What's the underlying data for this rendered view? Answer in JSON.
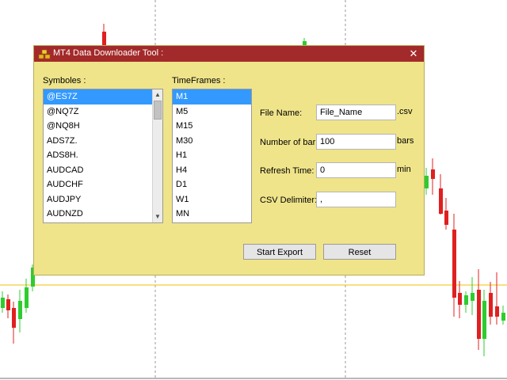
{
  "colors": {
    "title_bar": "#a32a2a",
    "dialog_bg": "#efe48a",
    "selection": "#3399ff",
    "bull_candle": "#2ecc2e",
    "bear_candle": "#e02020",
    "price_line": "#f2c200"
  },
  "dialog": {
    "title": "MT4 Data Downloader Tool :",
    "title_icon": "gold-bars-icon",
    "close_symbol": "✕",
    "symbols_label": "Symboles :",
    "timeframes_label": "TimeFrames :",
    "symbols": [
      {
        "label": "@ES7Z"
      },
      {
        "label": "@NQ7Z"
      },
      {
        "label": "@NQ8H"
      },
      {
        "label": "ADS7Z."
      },
      {
        "label": "ADS8H."
      },
      {
        "label": "AUDCAD"
      },
      {
        "label": "AUDCHF"
      },
      {
        "label": "AUDJPY"
      },
      {
        "label": "AUDNZD"
      }
    ],
    "symbols_selected": "@ES7Z",
    "timeframes": [
      {
        "label": "M1"
      },
      {
        "label": "M5"
      },
      {
        "label": "M15"
      },
      {
        "label": "M30"
      },
      {
        "label": "H1"
      },
      {
        "label": "H4"
      },
      {
        "label": "D1"
      },
      {
        "label": "W1"
      },
      {
        "label": "MN"
      }
    ],
    "timeframes_selected": "M1",
    "file_name_label": "File Name:",
    "file_name_value": "File_Name",
    "file_ext": ".csv",
    "bars_label": "Number of bar:",
    "bars_value": "100",
    "bars_unit": "bars",
    "refresh_label": "Refresh Time:",
    "refresh_value": "0",
    "refresh_unit": "min",
    "delimiter_label": "CSV Delimiter:",
    "delimiter_value": ",",
    "start_button": "Start Export",
    "reset_button": "Reset"
  }
}
